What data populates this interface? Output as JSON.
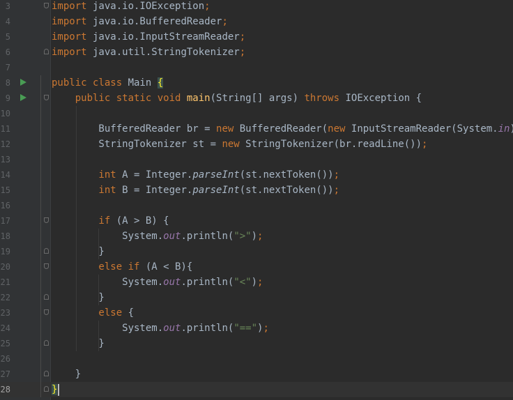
{
  "editor": {
    "language": "java",
    "current_line": "28",
    "colors": {
      "background": "#2b2b2b",
      "gutter": "#313335",
      "keyword": "#cc7832",
      "method_declaration": "#ffc66d",
      "string": "#6a8759",
      "static_field": "#9876aa",
      "default_text": "#a9b7c6",
      "run_icon": "#499c54"
    },
    "lines": [
      {
        "number": "3",
        "tokens": [
          {
            "t": "import",
            "c": "kw"
          },
          {
            "t": " java.io.IOException",
            "c": ""
          },
          {
            "t": ";",
            "c": "kw"
          }
        ]
      },
      {
        "number": "4",
        "tokens": [
          {
            "t": "import",
            "c": "kw"
          },
          {
            "t": " java.io.BufferedReader",
            "c": ""
          },
          {
            "t": ";",
            "c": "kw"
          }
        ]
      },
      {
        "number": "5",
        "tokens": [
          {
            "t": "import",
            "c": "kw"
          },
          {
            "t": " java.io.InputStreamReader",
            "c": ""
          },
          {
            "t": ";",
            "c": "kw"
          }
        ]
      },
      {
        "number": "6",
        "tokens": [
          {
            "t": "import",
            "c": "kw"
          },
          {
            "t": " java.util.StringTokenizer",
            "c": ""
          },
          {
            "t": ";",
            "c": "kw"
          }
        ]
      },
      {
        "number": "7",
        "tokens": []
      },
      {
        "number": "8",
        "tokens": [
          {
            "t": "public class ",
            "c": "kw"
          },
          {
            "t": "Main ",
            "c": ""
          },
          {
            "t": "{",
            "c": "brace-hl"
          }
        ]
      },
      {
        "number": "9",
        "tokens": [
          {
            "t": "    public static void ",
            "c": "kw"
          },
          {
            "t": "main",
            "c": "fn"
          },
          {
            "t": "(String[] args) ",
            "c": ""
          },
          {
            "t": "throws ",
            "c": "kw"
          },
          {
            "t": "IOException {",
            "c": ""
          }
        ]
      },
      {
        "number": "10",
        "tokens": []
      },
      {
        "number": "11",
        "tokens": [
          {
            "t": "        BufferedReader br = ",
            "c": ""
          },
          {
            "t": "new ",
            "c": "kw"
          },
          {
            "t": "BufferedReader(",
            "c": ""
          },
          {
            "t": "new ",
            "c": "kw"
          },
          {
            "t": "InputStreamReader(System.",
            "c": ""
          },
          {
            "t": "in",
            "c": "sf"
          },
          {
            "t": "))",
            "c": ""
          },
          {
            "t": ";",
            "c": "kw"
          }
        ]
      },
      {
        "number": "12",
        "tokens": [
          {
            "t": "        StringTokenizer st = ",
            "c": ""
          },
          {
            "t": "new ",
            "c": "kw"
          },
          {
            "t": "StringTokenizer(br.readLine())",
            "c": ""
          },
          {
            "t": ";",
            "c": "kw"
          }
        ]
      },
      {
        "number": "13",
        "tokens": []
      },
      {
        "number": "14",
        "tokens": [
          {
            "t": "        int ",
            "c": "kw"
          },
          {
            "t": "A = Integer.",
            "c": ""
          },
          {
            "t": "parseInt",
            "c": "it"
          },
          {
            "t": "(st.nextToken())",
            "c": ""
          },
          {
            "t": ";",
            "c": "kw"
          }
        ]
      },
      {
        "number": "15",
        "tokens": [
          {
            "t": "        int ",
            "c": "kw"
          },
          {
            "t": "B = Integer.",
            "c": ""
          },
          {
            "t": "parseInt",
            "c": "it"
          },
          {
            "t": "(st.nextToken())",
            "c": ""
          },
          {
            "t": ";",
            "c": "kw"
          }
        ]
      },
      {
        "number": "16",
        "tokens": []
      },
      {
        "number": "17",
        "tokens": [
          {
            "t": "        if ",
            "c": "kw"
          },
          {
            "t": "(A > B) {",
            "c": ""
          }
        ]
      },
      {
        "number": "18",
        "tokens": [
          {
            "t": "            System.",
            "c": ""
          },
          {
            "t": "out",
            "c": "sf"
          },
          {
            "t": ".println(",
            "c": ""
          },
          {
            "t": "\">\"",
            "c": "st"
          },
          {
            "t": ")",
            "c": ""
          },
          {
            "t": ";",
            "c": "kw"
          }
        ]
      },
      {
        "number": "19",
        "tokens": [
          {
            "t": "        }",
            "c": ""
          }
        ]
      },
      {
        "number": "20",
        "tokens": [
          {
            "t": "        else if ",
            "c": "kw"
          },
          {
            "t": "(A < B){",
            "c": ""
          }
        ]
      },
      {
        "number": "21",
        "tokens": [
          {
            "t": "            System.",
            "c": ""
          },
          {
            "t": "out",
            "c": "sf"
          },
          {
            "t": ".println(",
            "c": ""
          },
          {
            "t": "\"<\"",
            "c": "st"
          },
          {
            "t": ")",
            "c": ""
          },
          {
            "t": ";",
            "c": "kw"
          }
        ]
      },
      {
        "number": "22",
        "tokens": [
          {
            "t": "        }",
            "c": ""
          }
        ]
      },
      {
        "number": "23",
        "tokens": [
          {
            "t": "        else ",
            "c": "kw"
          },
          {
            "t": "{",
            "c": ""
          }
        ]
      },
      {
        "number": "24",
        "tokens": [
          {
            "t": "            System.",
            "c": ""
          },
          {
            "t": "out",
            "c": "sf"
          },
          {
            "t": ".println(",
            "c": ""
          },
          {
            "t": "\"==\"",
            "c": "st"
          },
          {
            "t": ")",
            "c": ""
          },
          {
            "t": ";",
            "c": "kw"
          }
        ]
      },
      {
        "number": "25",
        "tokens": [
          {
            "t": "        }",
            "c": ""
          }
        ]
      },
      {
        "number": "26",
        "tokens": []
      },
      {
        "number": "27",
        "tokens": [
          {
            "t": "    }",
            "c": ""
          }
        ]
      },
      {
        "number": "28",
        "tokens": [
          {
            "t": "}",
            "c": "brace-hl"
          }
        ]
      }
    ],
    "gutter_icons": {
      "8": [
        "run-icon"
      ],
      "9": [
        "run-icon",
        "fold-start-icon"
      ],
      "3": [
        "fold-start-icon"
      ],
      "6": [
        "fold-end-icon"
      ],
      "17": [
        "fold-start-icon"
      ],
      "19": [
        "fold-end-icon"
      ],
      "20": [
        "fold-start-icon"
      ],
      "22": [
        "fold-end-icon"
      ],
      "23": [
        "fold-start-icon"
      ],
      "25": [
        "fold-end-icon"
      ],
      "27": [
        "fold-end-icon"
      ],
      "28": [
        "fold-end-icon"
      ]
    }
  }
}
